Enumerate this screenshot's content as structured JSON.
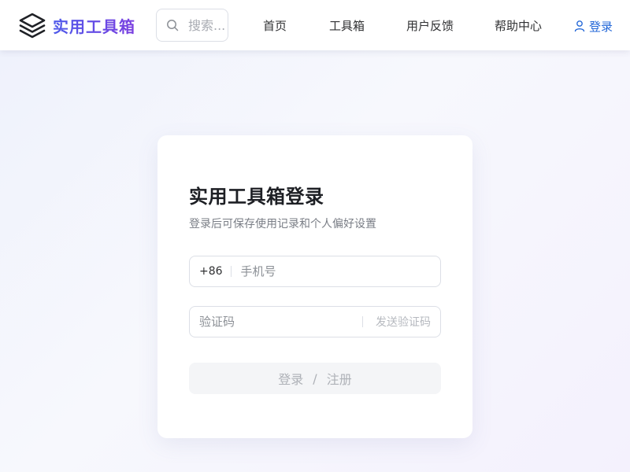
{
  "header": {
    "logo_text": "实用工具箱",
    "search": {
      "placeholder": "搜索...",
      "icon": "search-icon"
    },
    "nav": [
      {
        "label": "首页"
      },
      {
        "label": "工具箱"
      },
      {
        "label": "用户反馈"
      },
      {
        "label": "帮助中心"
      }
    ],
    "login": {
      "label": "登录",
      "icon": "user-icon"
    }
  },
  "card": {
    "title": "实用工具箱登录",
    "subtitle": "登录后可保存使用记录和个人偏好设置",
    "phone": {
      "prefix": "+86",
      "placeholder": "手机号",
      "value": ""
    },
    "code": {
      "placeholder": "验证码",
      "value": "",
      "send_label": "发送验证码"
    },
    "submit": {
      "login_label": "登录",
      "separator": "/",
      "register_label": "注册"
    }
  },
  "colors": {
    "brand_start": "#4f5bea",
    "brand_end": "#7b3fe0",
    "link": "#2468d8",
    "disabled_text": "#aeb1b7"
  }
}
